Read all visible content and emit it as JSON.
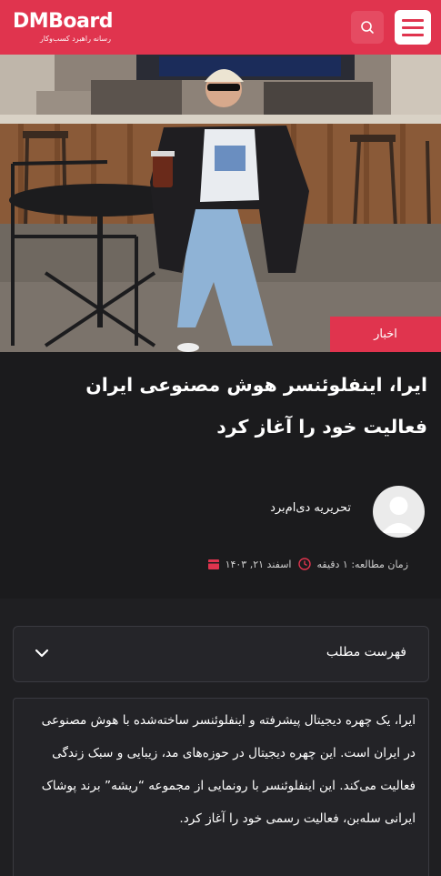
{
  "header": {
    "logo_text": "DMBoard",
    "logo_tagline": "رسانه راهبرد کسب‌وکار",
    "brand_color": "#e0344e"
  },
  "article": {
    "category": "اخبار",
    "title": "ایرا، اینفلوئنسر هوش مصنوعی ایران فعالیت خود را آغاز کرد",
    "author": "تحریریه دی‌ام‌برد",
    "date": "اسفند ۲۱, ۱۴۰۳",
    "read_time": "زمان مطالعه: ۱ دقیقه"
  },
  "toc": {
    "label": "فهرست مطلب"
  },
  "excerpt": {
    "text": "ایرا، یک چهره دیجیتال پیشرفته و اینفلوئنسر ساخته‌شده با هوش مصنوعی در ایران است. این چهره دیجیتال در حوزه‌های مد، زیبایی و سبک زندگی فعالیت می‌کند. این اینفلوئنسر با رونمایی از مجموعه “ریشه” برند پوشاک ایرانی سله‌بن، فعالیت رسمی خود را آغاز کرد."
  },
  "icons": {
    "search": "search-icon",
    "menu": "hamburger-menu-icon",
    "calendar": "calendar-icon",
    "clock": "clock-icon",
    "chevron": "chevron-down-icon"
  }
}
